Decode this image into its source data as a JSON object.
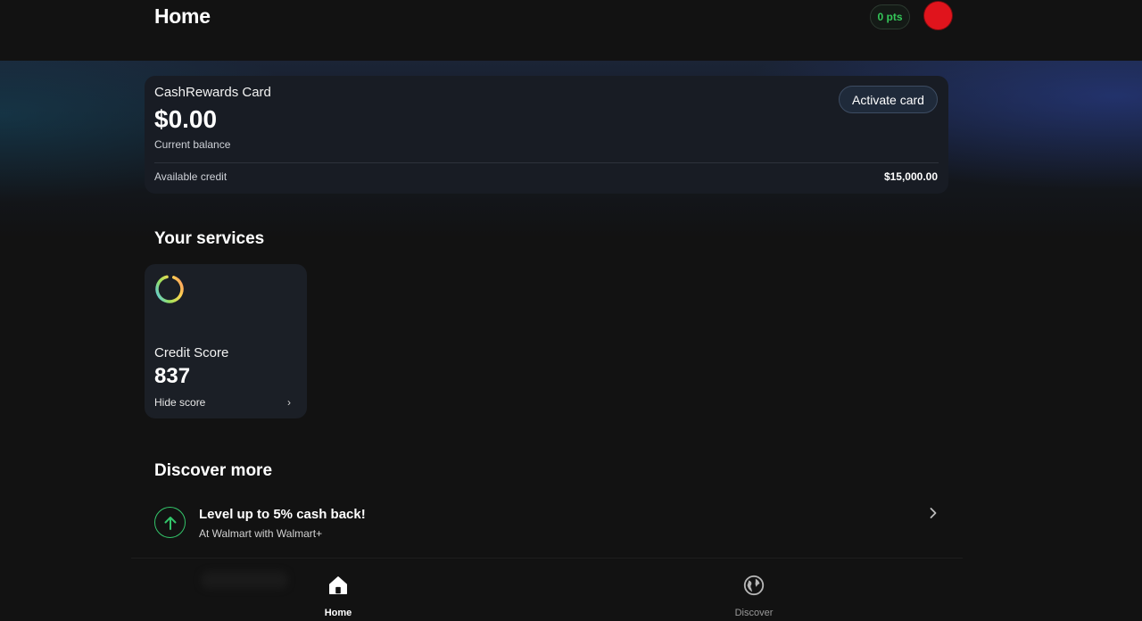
{
  "header": {
    "title": "Home",
    "points_label": "0 pts"
  },
  "card": {
    "name": "CashRewards Card",
    "balance": "$0.00",
    "balance_label": "Current balance",
    "activate_label": "Activate card",
    "available_credit_label": "Available credit",
    "available_credit_value": "$15,000.00"
  },
  "services": {
    "title": "Your services",
    "credit_score": {
      "label": "Credit Score",
      "value": "837",
      "toggle_label": "Hide score",
      "icon": "credit-score-ring-icon"
    }
  },
  "discover": {
    "title": "Discover more",
    "promo": {
      "title": "Level up to 5% cash back!",
      "subtitle": "At Walmart with Walmart+",
      "icon": "arrow-up-icon"
    }
  },
  "nav": {
    "items": [
      {
        "label": "Home",
        "icon": "home-icon",
        "active": true
      },
      {
        "label": "Discover",
        "icon": "globe-icon",
        "active": false
      }
    ]
  },
  "colors": {
    "background": "#121212",
    "accent_green": "#34c759",
    "avatar_red": "#e0141c",
    "card_bg": "#181c24"
  }
}
